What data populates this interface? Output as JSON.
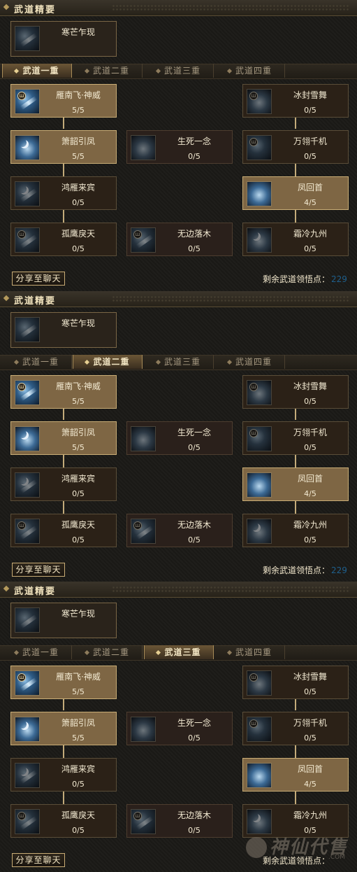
{
  "panels": [
    {
      "header": "武道精要",
      "top_skill": {
        "name": "寒芒乍现",
        "level": ""
      },
      "tabs": [
        "武道一重",
        "武道二重",
        "武道三重",
        "武道四重"
      ],
      "active_tab": 0,
      "skills": {
        "yannanfei": {
          "name": "雁南飞·神威",
          "level": "5/5"
        },
        "bingfeng": {
          "name": "冰封雪舞",
          "level": "0/5"
        },
        "xiaoshao": {
          "name": "箫韶引凤",
          "level": "5/5"
        },
        "shengsi": {
          "name": "生死一念",
          "level": "0/5"
        },
        "wanren": {
          "name": "万翎千机",
          "level": "0/5"
        },
        "hongyan": {
          "name": "鸿雁来宾",
          "level": "0/5"
        },
        "fenghui": {
          "name": "凤回首",
          "level": "4/5"
        },
        "guying": {
          "name": "孤鹰戾天",
          "level": "0/5"
        },
        "wubian": {
          "name": "无边落木",
          "level": "0/5"
        },
        "shuangleng": {
          "name": "霜冷九州",
          "level": "0/5"
        }
      },
      "share_button": "分享至聊天",
      "remaining_label": "剩余武道领悟点：",
      "remaining_points": "229"
    },
    {
      "header": "武道精要",
      "top_skill": {
        "name": "寒芒乍现",
        "level": ""
      },
      "tabs": [
        "武道一重",
        "武道二重",
        "武道三重",
        "武道四重"
      ],
      "active_tab": 1,
      "skills": {
        "yannanfei": {
          "name": "雁南飞·神威",
          "level": "5/5"
        },
        "bingfeng": {
          "name": "冰封雪舞",
          "level": "0/5"
        },
        "xiaoshao": {
          "name": "箫韶引凤",
          "level": "5/5"
        },
        "shengsi": {
          "name": "生死一念",
          "level": "0/5"
        },
        "wanren": {
          "name": "万翎千机",
          "level": "0/5"
        },
        "hongyan": {
          "name": "鸿雁来宾",
          "level": "0/5"
        },
        "fenghui": {
          "name": "凤回首",
          "level": "4/5"
        },
        "guying": {
          "name": "孤鹰戾天",
          "level": "0/5"
        },
        "wubian": {
          "name": "无边落木",
          "level": "0/5"
        },
        "shuangleng": {
          "name": "霜冷九州",
          "level": "0/5"
        }
      },
      "share_button": "分享至聊天",
      "remaining_label": "剩余武道领悟点：",
      "remaining_points": "229"
    },
    {
      "header": "武道精要",
      "top_skill": {
        "name": "寒芒乍现",
        "level": ""
      },
      "tabs": [
        "武道一重",
        "武道二重",
        "武道三重",
        "武道四重"
      ],
      "active_tab": 2,
      "skills": {
        "yannanfei": {
          "name": "雁南飞·神威",
          "level": "5/5"
        },
        "bingfeng": {
          "name": "冰封雪舞",
          "level": "0/5"
        },
        "xiaoshao": {
          "name": "箫韶引凤",
          "level": "5/5"
        },
        "shengsi": {
          "name": "生死一念",
          "level": "0/5"
        },
        "wanren": {
          "name": "万翎千机",
          "level": "0/5"
        },
        "hongyan": {
          "name": "鸿雁来宾",
          "level": "0/5"
        },
        "fenghui": {
          "name": "凤回首",
          "level": "4/5"
        },
        "guying": {
          "name": "孤鹰戾天",
          "level": "0/5"
        },
        "wubian": {
          "name": "无边落木",
          "level": "0/5"
        },
        "shuangleng": {
          "name": "霜冷九州",
          "level": "0/5"
        }
      },
      "share_button": "分享至聊天",
      "remaining_label": "剩余武道领悟点：",
      "remaining_points": ""
    }
  ],
  "watermark": {
    "text": "神仙代售",
    "suffix": ".COM"
  },
  "colors": {
    "highlight_slot": "#7e6644",
    "slot_border": "#5a4d38",
    "accent_text": "#f3ead2",
    "points_blue": "#1f5f8c"
  }
}
